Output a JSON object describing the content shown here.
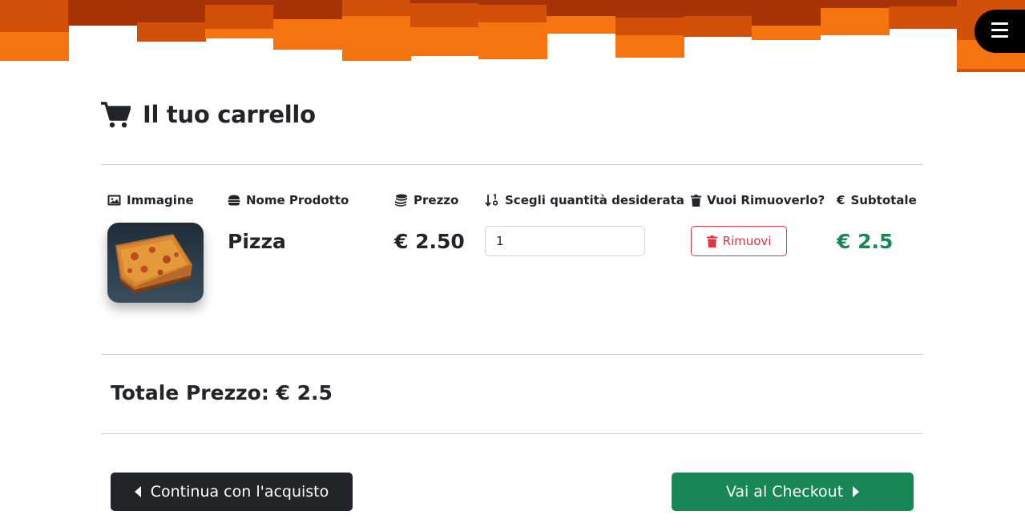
{
  "colors": {
    "band_dark": "#a83306",
    "band_mid": "#d25008",
    "band_light": "#f5740f",
    "danger": "#dc3545",
    "success": "#198754",
    "dark": "#212529"
  },
  "menu": {
    "icon": "hamburger-menu-icon"
  },
  "cart": {
    "title": "Il tuo carrello",
    "title_icon": "shopping-cart-icon",
    "headers": {
      "image": "Immagine",
      "name": "Nome Prodotto",
      "price": "Prezzo",
      "quantity": "Scegli quantità desiderata",
      "remove": "Vuoi Rimuoverlo?",
      "subtotal": "Subtotale"
    },
    "items": [
      {
        "name": "Pizza",
        "image": "pizza-photo",
        "price": "€ 2.50",
        "quantity": "1",
        "remove_label": "Rimuovi",
        "subtotal": "€ 2.5"
      }
    ],
    "total": "Totale Prezzo: € 2.5"
  },
  "actions": {
    "continue_label": "Continua con l'acquisto",
    "checkout_label": "Vai al Checkout"
  }
}
